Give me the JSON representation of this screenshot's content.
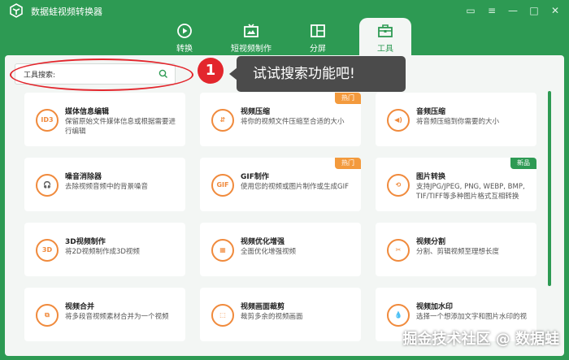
{
  "app": {
    "title": "数据蛙视频转换器"
  },
  "tabs": [
    {
      "label": "转换",
      "icon": "convert-icon"
    },
    {
      "label": "短视频制作",
      "icon": "tv-icon"
    },
    {
      "label": "分屏",
      "icon": "split-screen-icon"
    },
    {
      "label": "工具",
      "icon": "toolbox-icon",
      "active": true
    }
  ],
  "search": {
    "label": "工具搜索:",
    "value": "",
    "placeholder": ""
  },
  "callout": {
    "step": "1",
    "text": "试试搜索功能吧!"
  },
  "badges": {
    "hot": "热门",
    "new": "新品"
  },
  "cards": [
    {
      "title": "媒体信息编辑",
      "desc": "保留原始文件媒体信息或根据需要进行编辑",
      "icon_text": "ID3"
    },
    {
      "title": "视频压缩",
      "desc": "将你的视频文件压缩至合适的大小",
      "icon_text": "⇵",
      "badge": "hot"
    },
    {
      "title": "音频压缩",
      "desc": "将音频压缩到你需要的大小",
      "icon_text": "◀)"
    },
    {
      "title": "噪音消除器",
      "desc": "去除视频音频中的背景噪音",
      "icon_text": "🎧"
    },
    {
      "title": "GIF制作",
      "desc": "使用您的视频或图片制作或生成GIF",
      "icon_text": "GIF",
      "badge": "hot"
    },
    {
      "title": "图片转换",
      "desc": "支持JPG/JPEG, PNG, WEBP, BMP, TIF/TIFF等多种图片格式互相转换",
      "icon_text": "⟲",
      "badge": "new"
    },
    {
      "title": "3D视频制作",
      "desc": "将2D视频制作成3D视频",
      "icon_text": "3D"
    },
    {
      "title": "视频优化增强",
      "desc": "全面优化增强视频",
      "icon_text": "▦"
    },
    {
      "title": "视频分割",
      "desc": "分割、剪辑视频至理想长度",
      "icon_text": "✂"
    },
    {
      "title": "视频合并",
      "desc": "将多段音视频素材合并为一个视频",
      "icon_text": "⧉"
    },
    {
      "title": "视频画面裁剪",
      "desc": "裁剪多余的视频画面",
      "icon_text": "⬚"
    },
    {
      "title": "视频加水印",
      "desc": "选择一个想添加文字和图片水印的视",
      "icon_text": "💧"
    }
  ],
  "watermark": "掘金技术社区 @ 数据蛙"
}
